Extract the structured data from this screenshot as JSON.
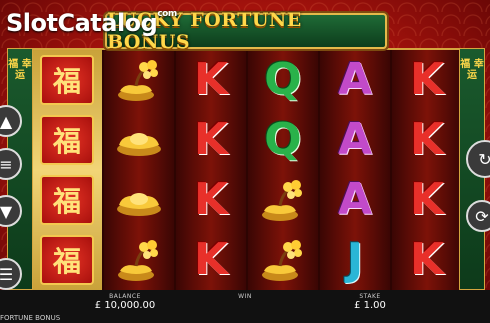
{
  "watermark": {
    "text": "SlotCatalog",
    "tm": "com"
  },
  "title": "LUCKY FORTUNE BONUS",
  "side_banner_chars": "福 幸 运",
  "reels": [
    [
      "fu",
      "fu",
      "fu",
      "fu"
    ],
    [
      "ingot-tree",
      "ingot",
      "ingot",
      "ingot-tree"
    ],
    [
      "K",
      "K",
      "K",
      "K"
    ],
    [
      "Q",
      "Q",
      "ingot-tree",
      "ingot-tree"
    ],
    [
      "A",
      "A",
      "A",
      "J"
    ],
    [
      "K",
      "K",
      "K",
      "K"
    ]
  ],
  "fu_char": "福",
  "footer": {
    "balance_label": "BALANCE",
    "balance_value": "£ 10,000.00",
    "win_label": "WIN",
    "stake_label": "STAKE",
    "stake_value": "£ 1.00",
    "game_name": "FORTUNE BONUS"
  },
  "colors": {
    "accent_gold": "#e5b94a",
    "reel_bg": "#7d1208",
    "banner_green": "#1f6b36"
  }
}
